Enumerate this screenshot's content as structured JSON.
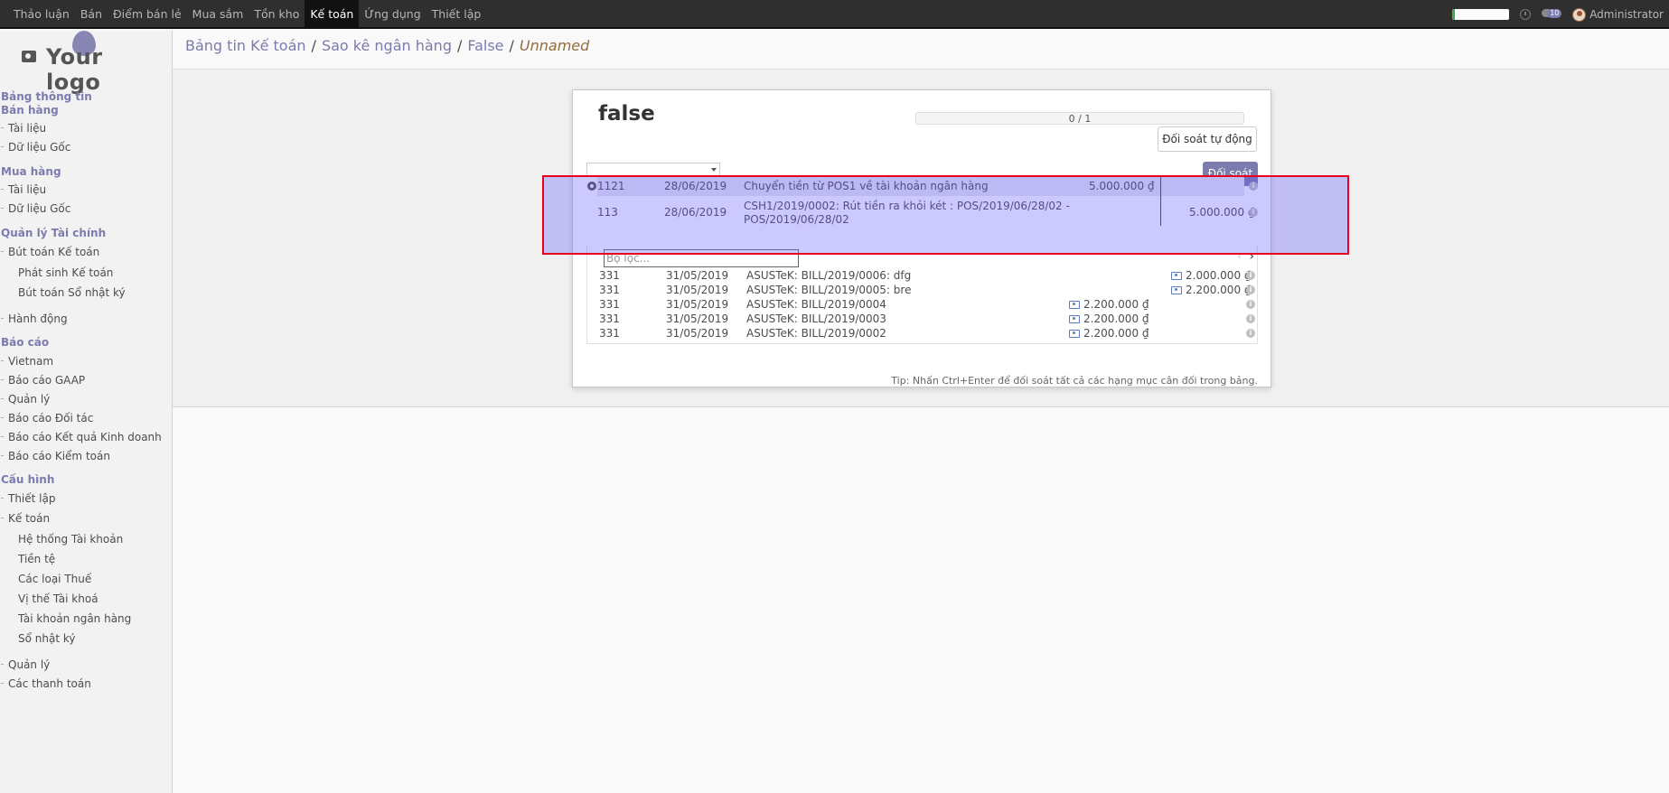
{
  "topbar": {
    "menu": [
      "Thảo luận",
      "Bán",
      "Điểm bán lẻ",
      "Mua sắm",
      "Tồn kho",
      "Kế toán",
      "Ứng dụng",
      "Thiết lập"
    ],
    "active_index": 5,
    "chat_count": "10",
    "user_name": "Administrator"
  },
  "logo": {
    "text": "Your logo"
  },
  "sidebar": {
    "sec_dashboard": "Bảng thông tin",
    "sec_sales": "Bán hàng",
    "sales_docs": "Tài liệu",
    "sales_master": "Dữ liệu Gốc",
    "sec_purchase": "Mua hàng",
    "purchase_docs": "Tài liệu",
    "purchase_master": "Dữ liệu Gốc",
    "sec_finance": "Quản lý Tài chính",
    "journal_entries": "Bút toán Kế toán",
    "journal_items": "Phát sinh Kế toán",
    "journal_book": "Bút toán Sổ nhật ký",
    "actions": "Hành động",
    "sec_reports": "Báo cáo",
    "rep_vietnam": "Vietnam",
    "rep_gaap": "Báo cáo GAAP",
    "rep_management": "Quản lý",
    "rep_partner": "Báo cáo Đối tác",
    "rep_pnl": "Báo cáo Kết quả Kinh doanh",
    "rep_audit": "Báo cáo Kiểm toán",
    "sec_config": "Cấu hình",
    "cfg_settings": "Thiết lập",
    "cfg_accounting": "Kế toán",
    "cfg_coa": "Hệ thống Tài khoản",
    "cfg_currency": "Tiền tệ",
    "cfg_taxes": "Các loại Thuế",
    "cfg_fiscal": "Vị thế Tài khoá",
    "cfg_bank": "Tài khoản ngân hàng",
    "cfg_journals": "Sổ nhật ký",
    "management": "Quản lý",
    "payments": "Các thanh toán"
  },
  "breadcrumb": {
    "b1": "Bảng tin Kế toán",
    "b2": "Sao kê ngân hàng",
    "b3": "False",
    "b4": "Unnamed",
    "sep": "/"
  },
  "sheet": {
    "title": "false",
    "progress_text": "0 / 1",
    "auto_reconcile": "Đối soát tự động",
    "reconcile": "Đối soát",
    "filter_placeholder": "Bộ lọc...",
    "tip": "Tip: Nhấn Ctrl+Enter để đối soát tất cả các hạng mục cân đối trong bảng."
  },
  "statement_line": {
    "account": "1121",
    "date": "28/06/2019",
    "label": "Chuyển tiền từ POS1 về tài khoản ngân hàng",
    "amount": "5.000.000 ₫"
  },
  "matched_line": {
    "account": "113",
    "date": "28/06/2019",
    "label_line1": "CSH1/2019/0002: Rút tiền ra khỏi két : POS/2019/06/28/02 -",
    "label_line2": "POS/2019/06/28/02",
    "credit": "5.000.000 ₫"
  },
  "proposition_lines": [
    {
      "account": "331",
      "date": "31/05/2019",
      "label": "ASUSTeK: BILL/2019/0006: dfg",
      "debit": "",
      "credit": "2.000.000 ₫"
    },
    {
      "account": "331",
      "date": "31/05/2019",
      "label": "ASUSTeK: BILL/2019/0005: bre",
      "debit": "",
      "credit": "2.200.000 ₫"
    },
    {
      "account": "331",
      "date": "31/05/2019",
      "label": "ASUSTeK: BILL/2019/0004",
      "debit": "2.200.000 ₫",
      "credit": ""
    },
    {
      "account": "331",
      "date": "31/05/2019",
      "label": "ASUSTeK: BILL/2019/0003",
      "debit": "2.200.000 ₫",
      "credit": ""
    },
    {
      "account": "331",
      "date": "31/05/2019",
      "label": "ASUSTeK: BILL/2019/0002",
      "debit": "2.200.000 ₫",
      "credit": ""
    }
  ],
  "colors": {
    "accent": "#7c7bad",
    "highlight": "#6056ff",
    "highlight_border": "#e8001f",
    "topbar": "#2f2f2f"
  }
}
